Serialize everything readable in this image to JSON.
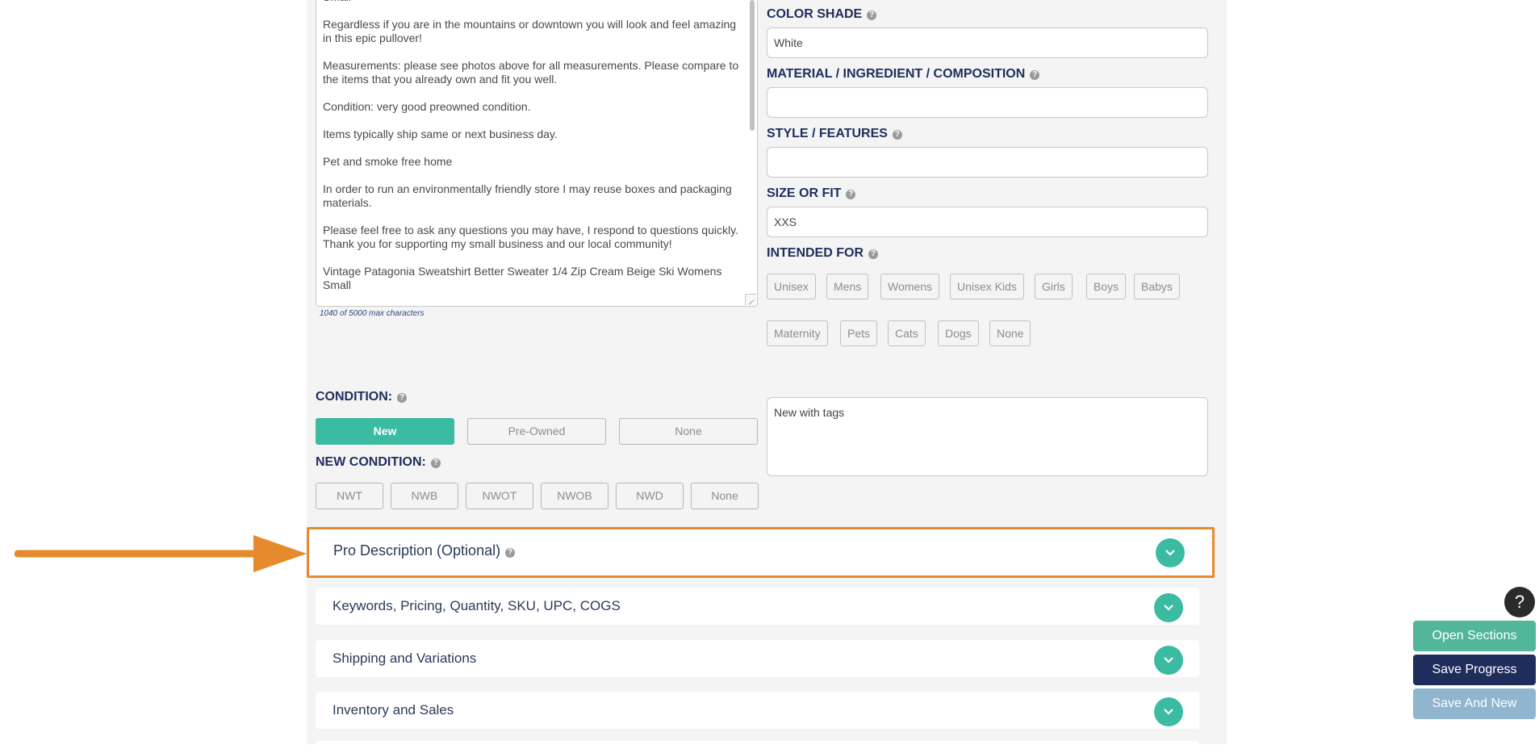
{
  "description": {
    "text": "Small\n\nRegardless if you are in the mountains or downtown you will look and feel amazing in this epic pullover!\n\nMeasurements: please see photos above for all measurements. Please compare to the items that you already own and fit you well.\n\nCondition: very good preowned condition.\n\nItems typically ship same or next business day.\n\nPet and smoke free home\n\nIn order to run an environmentally friendly store I may reuse boxes and packaging materials.\n\nPlease feel free to ask any questions you may have, I respond to questions quickly. Thank you for supporting my small business and our local community!\n\nVintage Patagonia Sweatshirt Better Sweater 1/4 Zip Cream Beige Ski Womens Small",
    "char_count": "1040 of 5000 max characters"
  },
  "fields": {
    "color_shade": {
      "label": "COLOR SHADE",
      "value": "White"
    },
    "material": {
      "label": "MATERIAL / INGREDIENT / COMPOSITION",
      "value": ""
    },
    "style": {
      "label": "STYLE / FEATURES",
      "value": ""
    },
    "size": {
      "label": "SIZE OR FIT",
      "value": "XXS"
    },
    "intended_for": {
      "label": "INTENDED FOR",
      "options": [
        "Unisex",
        "Mens",
        "Womens",
        "Unisex Kids",
        "Girls",
        "Boys",
        "Babys",
        "Maternity",
        "Pets",
        "Cats",
        "Dogs",
        "None"
      ]
    }
  },
  "condition": {
    "label": "CONDITION:",
    "options": [
      "New",
      "Pre-Owned",
      "None"
    ],
    "selected": "New",
    "note": "New with tags"
  },
  "new_condition": {
    "label": "NEW CONDITION:",
    "options": [
      "NWT",
      "NWB",
      "NWOT",
      "NWOB",
      "NWD",
      "None"
    ]
  },
  "sections": [
    "Pro Description (Optional)",
    "Keywords, Pricing, Quantity, SKU, UPC, COGS",
    "Shipping and Variations",
    "Inventory and Sales"
  ],
  "floating": {
    "help": "?",
    "open_sections": "Open Sections",
    "save_progress": "Save Progress",
    "save_and_new": "Save And New"
  },
  "colors": {
    "accent": "#3bbba2",
    "highlight": "#e68a2e",
    "save_progress_bg": "#1f2d5c",
    "save_new_bg": "#8fb5cf",
    "open_sections_bg": "#52b79a"
  }
}
